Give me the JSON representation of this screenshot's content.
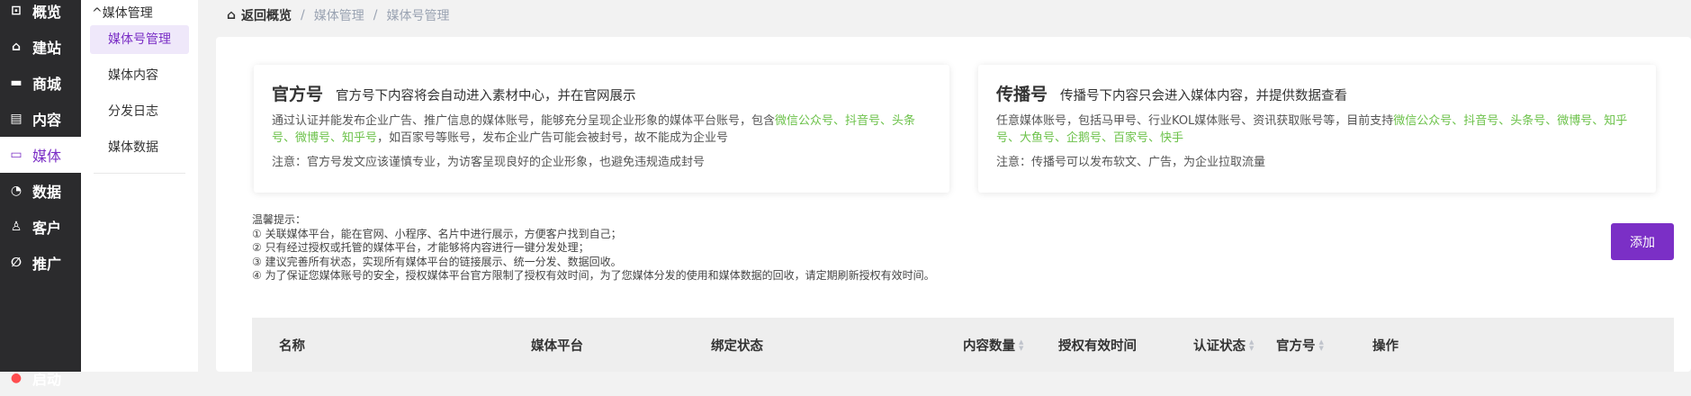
{
  "nav": [
    {
      "label": "概览",
      "icon": "overview-icon",
      "glyph": "⊡"
    },
    {
      "label": "建站",
      "icon": "home-icon",
      "glyph": "⌂"
    },
    {
      "label": "商城",
      "icon": "shop-icon",
      "glyph": "▬"
    },
    {
      "label": "内容",
      "icon": "document-icon",
      "glyph": "▤"
    },
    {
      "label": "媒体",
      "icon": "media-icon",
      "glyph": "▭"
    },
    {
      "label": "数据",
      "icon": "pie-chart-icon",
      "glyph": "◔"
    },
    {
      "label": "客户",
      "icon": "user-icon",
      "glyph": "♙"
    },
    {
      "label": "推广",
      "icon": "paperclip-icon",
      "glyph": "∅"
    },
    {
      "label": "启动",
      "icon": "launch-icon",
      "glyph": "●"
    }
  ],
  "submenu": {
    "title": "媒体管理",
    "items": [
      "媒体号管理",
      "媒体内容",
      "分发日志",
      "媒体数据"
    ]
  },
  "breadcrumb": {
    "home": "返回概览",
    "items": [
      "媒体管理",
      "媒体号管理"
    ]
  },
  "official": {
    "title": "官方号",
    "subtitle": "官方号下内容将会自动进入素材中心，并在官网展示",
    "desc1": "通过认证并能发布企业广告、推广信息的媒体账号，能够充分呈现企业形象的媒体平台账号，包含",
    "platforms": "微信公众号、抖音号、头条号、微博号、知乎号",
    "desc2": "，如百家号等账号，发布企业广告可能会被封号，故不能成为企业号",
    "note": "注意：官方号发文应该谨慎专业，为访客呈现良好的企业形象，也避免违规造成封号"
  },
  "spread": {
    "title": "传播号",
    "subtitle": "传播号下内容只会进入媒体内容，并提供数据查看",
    "desc1": "任意媒体账号，包括马甲号、行业KOL媒体账号、资讯获取账号等，目前支持",
    "platforms": "微信公众号、抖音号、头条号、微博号、知乎号、大鱼号、企鹅号、百家号、快手",
    "note": "注意：传播号可以发布软文、广告，为企业拉取流量"
  },
  "tips": {
    "title": "温馨提示：",
    "items": [
      "① 关联媒体平台，能在官网、小程序、名片中进行展示，方便客户找到自己；",
      "② 只有经过授权或托管的媒体平台，才能够将内容进行一键分发处理；",
      "③ 建议完善所有状态，实现所有媒体平台的链接展示、统一分发、数据回收。",
      "④ 为了保证您媒体账号的安全，授权媒体平台官方限制了授权有效时间，为了您媒体分发的使用和媒体数据的回收，请定期刷新授权有效时间。"
    ]
  },
  "add_label": "添加",
  "table": {
    "columns": [
      "名称",
      "媒体平台",
      "绑定状态",
      "内容数量",
      "授权有效时间",
      "认证状态",
      "官方号",
      "操作"
    ]
  },
  "colors": {
    "accent": "#7b2fc6",
    "green": "#6cc24a",
    "sidebar": "#2b2b2d"
  }
}
